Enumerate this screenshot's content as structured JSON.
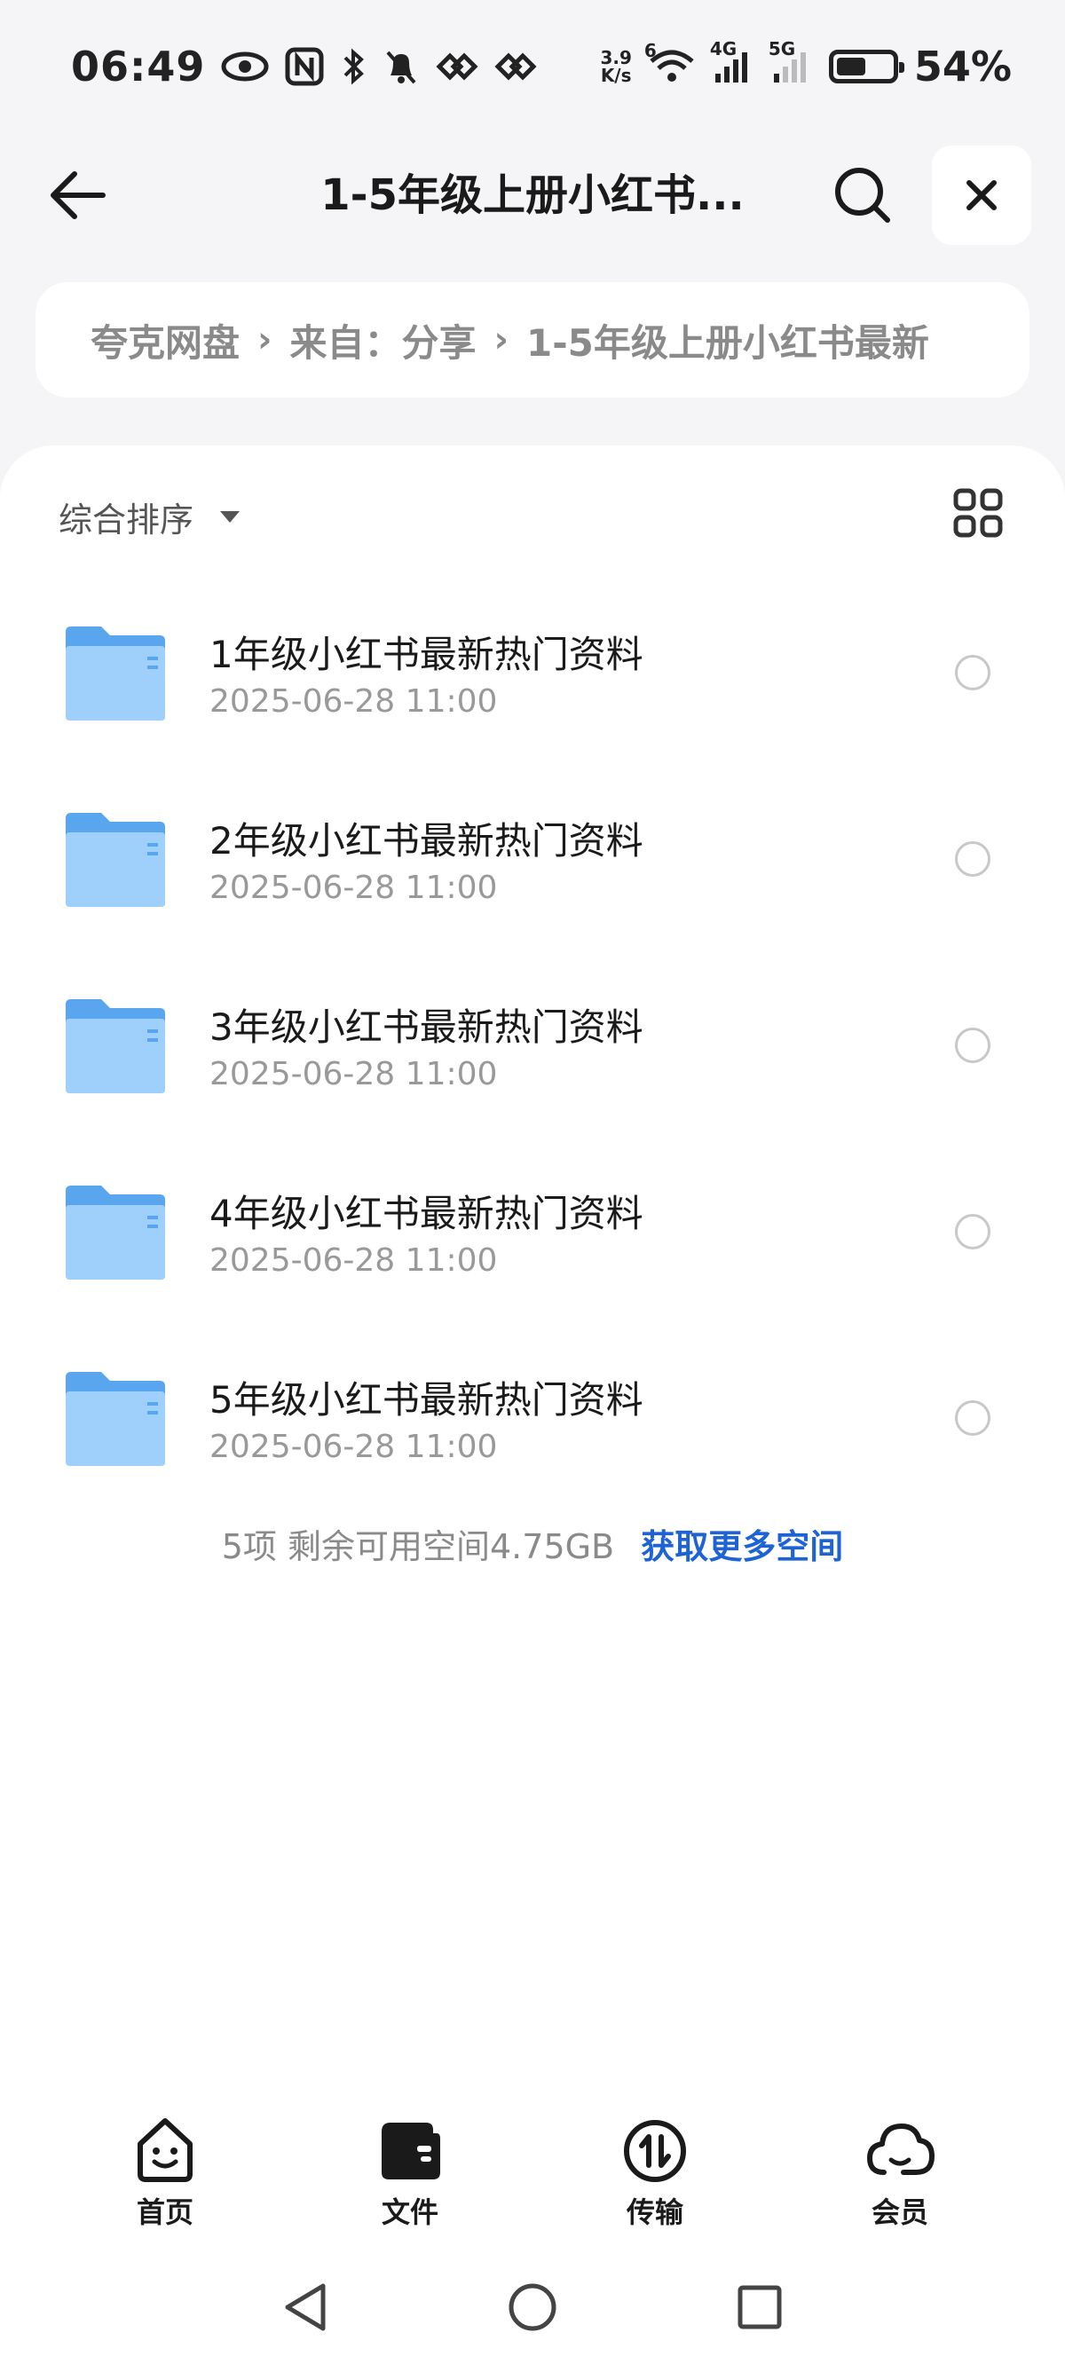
{
  "status_bar": {
    "time": "06:49",
    "net_speed_value": "3.9",
    "net_speed_unit": "K/s",
    "wifi_sub": "6",
    "signal1_label": "4G",
    "signal2_label": "5G",
    "battery_percent": "54%",
    "battery_level": 0.54,
    "icons": [
      "eye-icon",
      "nfc-icon",
      "bluetooth-icon",
      "bell-muted-icon",
      "heart-link-icon",
      "heart-link-icon"
    ]
  },
  "header": {
    "title": "1-5年级上册小红书..."
  },
  "breadcrumb": {
    "items": [
      "夸克网盘",
      "来自：分享",
      "1-5年级上册小红书最新"
    ]
  },
  "sort": {
    "label": "综合排序"
  },
  "files": [
    {
      "name": "1年级小红书最新热门资料",
      "date": "2025-06-28 11:00"
    },
    {
      "name": "2年级小红书最新热门资料",
      "date": "2025-06-28 11:00"
    },
    {
      "name": "3年级小红书最新热门资料",
      "date": "2025-06-28 11:00"
    },
    {
      "name": "4年级小红书最新热门资料",
      "date": "2025-06-28 11:00"
    },
    {
      "name": "5年级小红书最新热门资料",
      "date": "2025-06-28 11:00"
    }
  ],
  "summary": {
    "text": "5项 剩余可用空间4.75GB",
    "link": "获取更多空间"
  },
  "bottom_nav": {
    "items": [
      {
        "label": "首页",
        "icon": "smile-home-icon"
      },
      {
        "label": "文件",
        "icon": "wallet-folder-icon"
      },
      {
        "label": "传输",
        "icon": "transfer-icon"
      },
      {
        "label": "会员",
        "icon": "cloud-icon"
      }
    ]
  },
  "colors": {
    "accent_link": "#1e63d6",
    "folder_blue": "#7dbcf3",
    "background": "#f5f5f7"
  }
}
